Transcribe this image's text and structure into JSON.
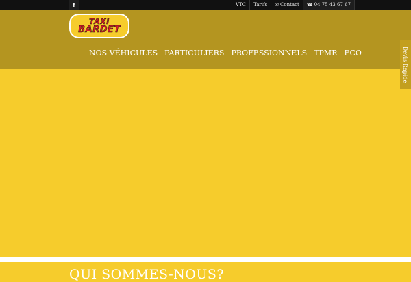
{
  "topbar": {
    "facebook_icon": "f",
    "links": {
      "vtc": "VTC",
      "tarifs": "Tarifs",
      "contact": "Contact",
      "phone": "04 75 43 67 67"
    },
    "contact_icon": "envelope-icon",
    "phone_icon": "phone-icon"
  },
  "logo": {
    "line1": "TAXI",
    "line2": "BARDET"
  },
  "nav": {
    "items": [
      "NOS VÉHICULES",
      "PARTICULIERS",
      "PROFESSIONNELS",
      "TPMR",
      "ECO"
    ]
  },
  "quote_tab": {
    "label": "Devis Rapide"
  },
  "section": {
    "title": "QUI SOMMES-NOUS?"
  },
  "colors": {
    "background": "#F6CC2C",
    "header": "#B49520",
    "topbar": "#111111",
    "logo_text": "#d61f26"
  }
}
